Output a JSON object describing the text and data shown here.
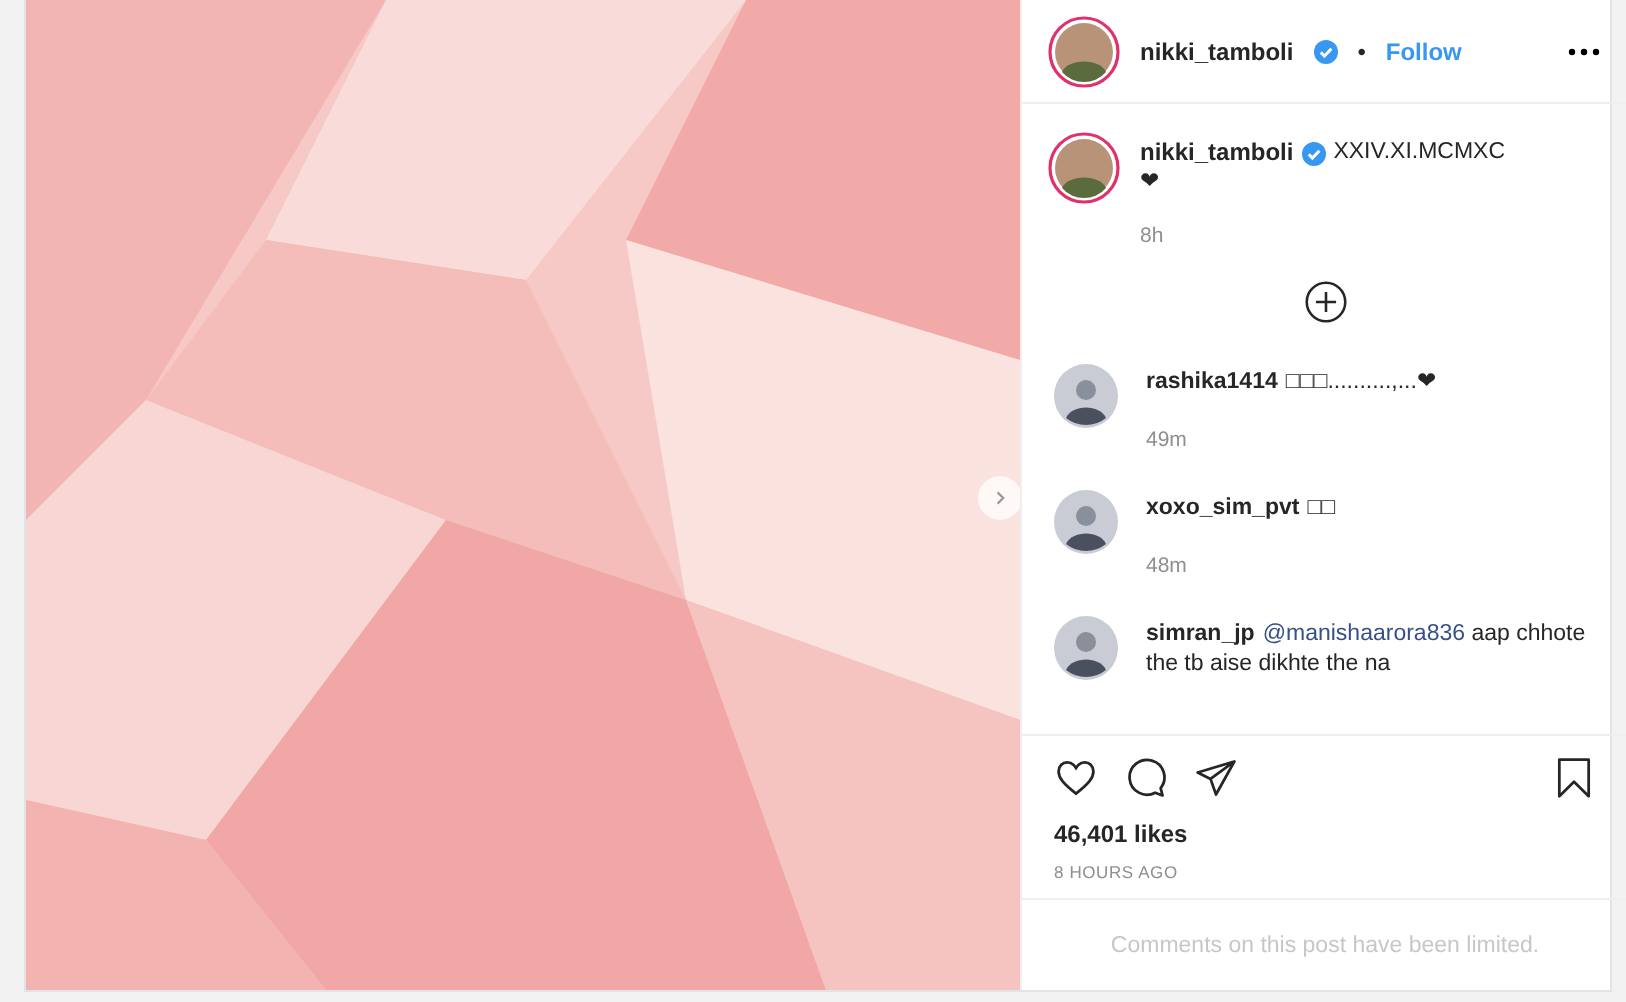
{
  "post": {
    "header": {
      "username": "nikki_tamboli",
      "verified": true,
      "separator": "•",
      "follow": "Follow"
    },
    "caption": {
      "username": "nikki_tamboli",
      "verified": true,
      "text": "XXIV.XI.MCMXC",
      "second_line": "❤",
      "time": "8h"
    },
    "comments": [
      {
        "username": "rashika1414",
        "text": "□□□..........,...❤",
        "time": "49m"
      },
      {
        "username": "xoxo_sim_pvt",
        "text": "□□",
        "time": "48m"
      },
      {
        "username": "simran_jp",
        "mention": "@manishaarora836",
        "text": "aap chhote the tb aise dikhte the na"
      }
    ],
    "likes": "46,401 likes",
    "posted": "8 HOURS AGO",
    "notice": "Comments on this post have been limited."
  }
}
